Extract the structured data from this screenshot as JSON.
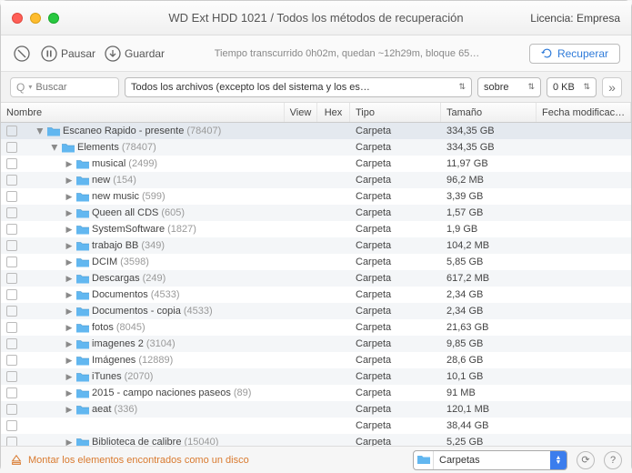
{
  "window": {
    "title": "WD Ext HDD 1021 / Todos los métodos de recuperación",
    "license": "Licencia: Empresa"
  },
  "toolbar": {
    "pause": "Pausar",
    "save": "Guardar",
    "status": "Tiempo transcurrido 0h02m, quedan ~12h29m, bloque 65…",
    "recover": "Recuperar"
  },
  "filters": {
    "search_placeholder": "Buscar",
    "filter1": "Todos los archivos (excepto los del sistema y los es…",
    "filter2": "sobre",
    "filter3": "0 KB"
  },
  "columns": {
    "name": "Nombre",
    "view": "View",
    "hex": "Hex",
    "type": "Tipo",
    "size": "Tamaño",
    "date": "Fecha modificac…"
  },
  "rows": [
    {
      "indent": 0,
      "expanded": true,
      "name": "Escaneo Rapido - presente",
      "count": "(78407)",
      "type": "Carpeta",
      "size": "334,35 GB",
      "sel": true
    },
    {
      "indent": 1,
      "expanded": true,
      "name": "Elements",
      "count": "(78407)",
      "type": "Carpeta",
      "size": "334,35 GB"
    },
    {
      "indent": 2,
      "expanded": false,
      "name": "musical",
      "count": "(2499)",
      "type": "Carpeta",
      "size": "11,97 GB"
    },
    {
      "indent": 2,
      "expanded": false,
      "name": "new",
      "count": "(154)",
      "type": "Carpeta",
      "size": "96,2 MB"
    },
    {
      "indent": 2,
      "expanded": false,
      "name": "new music",
      "count": "(599)",
      "type": "Carpeta",
      "size": "3,39 GB"
    },
    {
      "indent": 2,
      "expanded": false,
      "name": "Queen all CDS",
      "count": "(605)",
      "type": "Carpeta",
      "size": "1,57 GB"
    },
    {
      "indent": 2,
      "expanded": false,
      "name": "SystemSoftware",
      "count": "(1827)",
      "type": "Carpeta",
      "size": "1,9 GB"
    },
    {
      "indent": 2,
      "expanded": false,
      "name": "trabajo BB",
      "count": "(349)",
      "type": "Carpeta",
      "size": "104,2 MB"
    },
    {
      "indent": 2,
      "expanded": false,
      "name": "DCIM",
      "count": "(3598)",
      "type": "Carpeta",
      "size": "5,85 GB"
    },
    {
      "indent": 2,
      "expanded": false,
      "name": "Descargas",
      "count": "(249)",
      "type": "Carpeta",
      "size": "617,2 MB"
    },
    {
      "indent": 2,
      "expanded": false,
      "name": "Documentos",
      "count": "(4533)",
      "type": "Carpeta",
      "size": "2,34 GB"
    },
    {
      "indent": 2,
      "expanded": false,
      "name": "Documentos - copia",
      "count": "(4533)",
      "type": "Carpeta",
      "size": "2,34 GB"
    },
    {
      "indent": 2,
      "expanded": false,
      "name": "fotos",
      "count": "(8045)",
      "type": "Carpeta",
      "size": "21,63 GB"
    },
    {
      "indent": 2,
      "expanded": false,
      "name": "imagenes 2",
      "count": "(3104)",
      "type": "Carpeta",
      "size": "9,85 GB"
    },
    {
      "indent": 2,
      "expanded": false,
      "name": "Imágenes",
      "count": "(12889)",
      "type": "Carpeta",
      "size": "28,6 GB"
    },
    {
      "indent": 2,
      "expanded": false,
      "name": "iTunes",
      "count": "(2070)",
      "type": "Carpeta",
      "size": "10,1 GB"
    },
    {
      "indent": 2,
      "expanded": false,
      "name": "2015 - campo naciones paseos",
      "count": "(89)",
      "type": "Carpeta",
      "size": "91 MB"
    },
    {
      "indent": 2,
      "expanded": false,
      "name": "aeat",
      "count": "(336)",
      "type": "Carpeta",
      "size": "120,1 MB"
    },
    {
      "indent": 2,
      "expanded": false,
      "name": "",
      "count": "",
      "type": "Carpeta",
      "size": "38,44 GB",
      "noicon": true
    },
    {
      "indent": 2,
      "expanded": false,
      "name": "Biblioteca de calibre",
      "count": "(15040)",
      "type": "Carpeta",
      "size": "5,25 GB"
    }
  ],
  "footer": {
    "mount": "Montar los elementos encontrados como un disco",
    "select": "Carpetas"
  }
}
